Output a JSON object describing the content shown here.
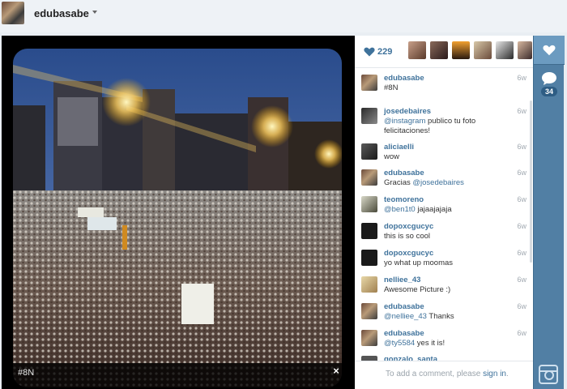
{
  "header": {
    "username": "edubasabe"
  },
  "post": {
    "caption": "#8N",
    "close_glyph": "×",
    "likes_count": "229"
  },
  "comments": [
    {
      "user": "edubasabe",
      "text": "#8N",
      "time": "6w",
      "mention": ""
    },
    {
      "user": "josedebaires",
      "text": " publico tu foto felicitaciones!",
      "mention": "@instagram",
      "time": "6w"
    },
    {
      "user": "aliciaelli",
      "text": "wow",
      "time": "6w",
      "mention": ""
    },
    {
      "user": "edubasabe",
      "text": "Gracias ",
      "mention_after": "@josedebaires",
      "time": "6w",
      "mention": ""
    },
    {
      "user": "teomoreno",
      "text": " jajaajajaja",
      "mention": "@ben1t0",
      "time": "6w"
    },
    {
      "user": "dopoxcgucyc",
      "text": "this is so cool",
      "time": "6w",
      "mention": ""
    },
    {
      "user": "dopoxcgucyc",
      "text": "yo what up moomas",
      "time": "6w",
      "mention": ""
    },
    {
      "user": "nelliee_43",
      "text": "Awesome Picture :)",
      "time": "6w",
      "mention": ""
    },
    {
      "user": "edubasabe",
      "text": " Thanks",
      "mention": "@nelliee_43",
      "time": "6w"
    },
    {
      "user": "edubasabe",
      "text": " yes it is!",
      "mention": "@ty5584",
      "time": "6w"
    },
    {
      "user": "gonzalo_santa",
      "text": "",
      "time": "",
      "mention": ""
    }
  ],
  "comment_box": {
    "prefix": "To add a comment, please ",
    "link": "sign in",
    "suffix": "."
  },
  "sidebar": {
    "comment_count": "34"
  },
  "colors": {
    "accent": "#3f729b",
    "sidebar": "#517fa4"
  },
  "icons": [
    "heart-icon",
    "comment-icon",
    "instagram-icon",
    "close-icon",
    "chevron-down-icon"
  ]
}
